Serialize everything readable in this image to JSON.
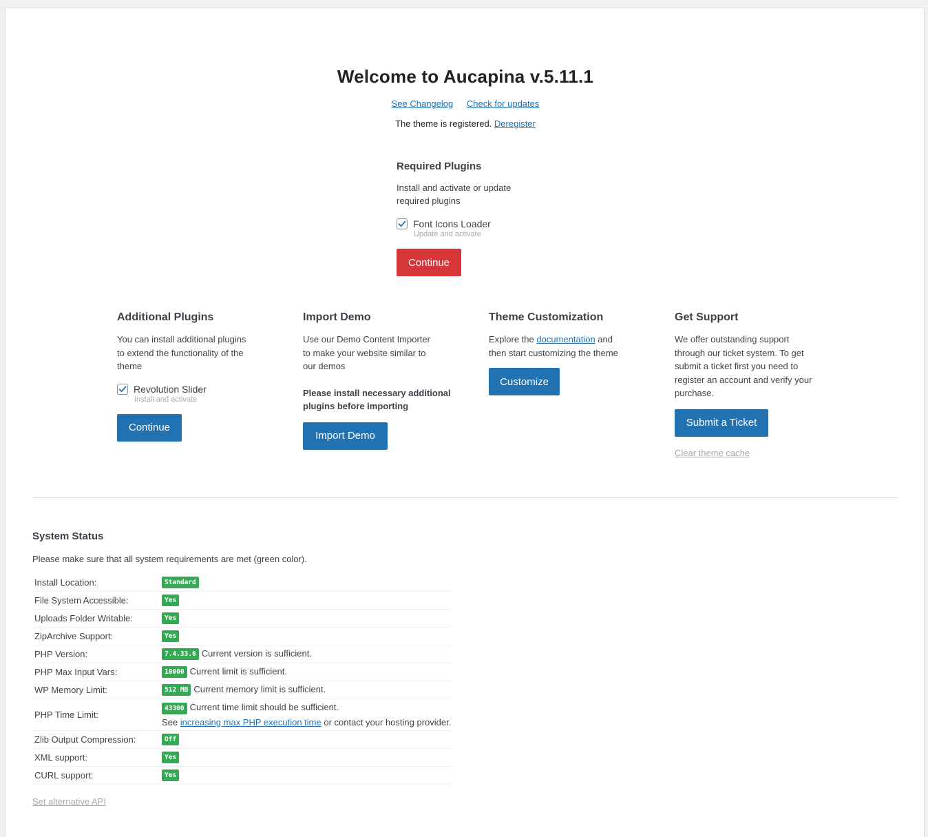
{
  "header": {
    "title": "Welcome to Aucapina v.5.11.1",
    "changelog_link": "See Changelog",
    "updates_link": "Check for updates",
    "registered_text": "The theme is registered.",
    "deregister_link": "Deregister"
  },
  "required_plugins": {
    "title": "Required Plugins",
    "description": "Install and activate or update required plugins",
    "plugin_name": "Font Icons Loader",
    "plugin_action": "Update and activate",
    "checked": true,
    "button_label": "Continue"
  },
  "additional_plugins": {
    "title": "Additional Plugins",
    "description": "You can install additional plugins to extend the functionality of the theme",
    "plugin_name": "Revolution Slider",
    "plugin_action": "Install and activate",
    "checked": true,
    "button_label": "Continue"
  },
  "import_demo": {
    "title": "Import Demo",
    "description": "Use our Demo Content Importer to make your website similar to our demos",
    "warning": "Please install necessary additional plugins before importing",
    "button_label": "Import Demo"
  },
  "theme_customization": {
    "title": "Theme Customization",
    "text_before": "Explore the",
    "doc_link": "documentation",
    "text_after": "and then start customizing the theme",
    "button_label": "Customize"
  },
  "support": {
    "title": "Get Support",
    "description": "We offer outstanding support through our ticket system. To get submit a ticket first you need to register an account and verify your purchase.",
    "button_label": "Submit a Ticket",
    "clear_cache_link": "Clear theme cache"
  },
  "system_status": {
    "title": "System Status",
    "intro": "Please make sure that all system requirements are met (green color).",
    "rows": [
      {
        "label": "Install Location:",
        "badge": "Standard",
        "note": ""
      },
      {
        "label": "File System Accessible:",
        "badge": "Yes",
        "note": ""
      },
      {
        "label": "Uploads Folder Writable:",
        "badge": "Yes",
        "note": ""
      },
      {
        "label": "ZipArchive Support:",
        "badge": "Yes",
        "note": ""
      },
      {
        "label": "PHP Version:",
        "badge": "7.4.33.6",
        "note": "Current version is sufficient."
      },
      {
        "label": "PHP Max Input Vars:",
        "badge": "10000",
        "note": "Current limit is sufficient."
      },
      {
        "label": "WP Memory Limit:",
        "badge": "512 MB",
        "note": "Current memory limit is sufficient."
      },
      {
        "label": "PHP Time Limit:",
        "badge": "43300",
        "note": "Current time limit should be sufficient."
      },
      {
        "label": "Zlib Output Compression:",
        "badge": "Off",
        "note": ""
      },
      {
        "label": "XML support:",
        "badge": "Yes",
        "note": ""
      },
      {
        "label": "CURL support:",
        "badge": "Yes",
        "note": ""
      }
    ],
    "time_limit_see": "See",
    "time_limit_link": "increasing max PHP execution time",
    "time_limit_after": "or contact your hosting provider.",
    "alt_api_link": "Set alternative API"
  },
  "colors": {
    "accent_blue": "#2271b1",
    "accent_red": "#d63638",
    "status_green": "#34a853"
  }
}
